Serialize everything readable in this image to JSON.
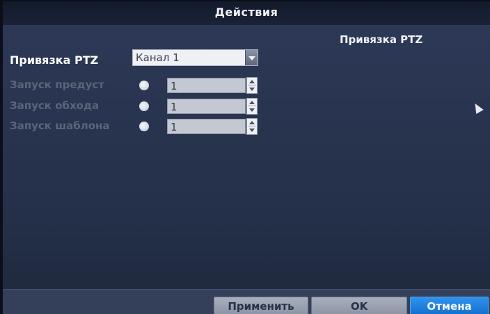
{
  "header": {
    "title": "Действия"
  },
  "tabs": {
    "active": "Привязка PTZ"
  },
  "ptz": {
    "label": "Привязка PTZ",
    "channel_value": "Канал 1"
  },
  "rows": [
    {
      "label": "Запуск предуст",
      "value": "1"
    },
    {
      "label": "Запуск обхода",
      "value": "1"
    },
    {
      "label": "Запуск шаблона",
      "value": "1"
    }
  ],
  "footer": {
    "apply_label": "Применить",
    "ok_label": "OK",
    "cancel_label": "Отмена"
  },
  "colors": {
    "panel": "#293450",
    "accent_button": "#1f84e3",
    "disabled_text": "#5a6578"
  },
  "icons": {
    "cursor": "mouse-pointer-icon",
    "dropdown": "chevron-down-icon",
    "spinner": "up-down-spinner-icon"
  }
}
